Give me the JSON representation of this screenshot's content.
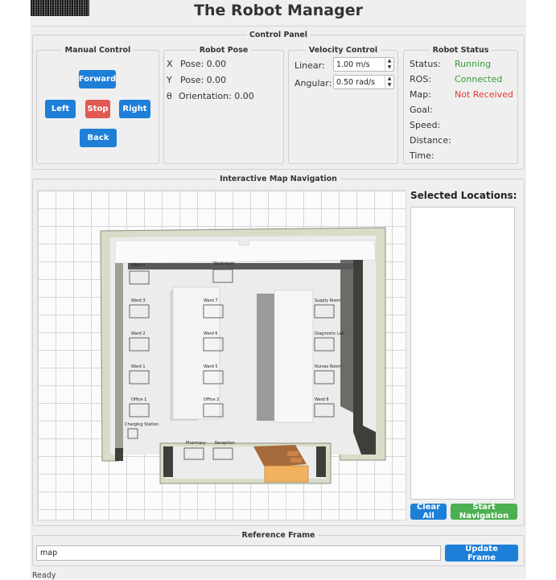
{
  "app": {
    "title": "The Robot Manager"
  },
  "control_panel": {
    "title": "Control Panel",
    "manual": {
      "title": "Manual Control",
      "forward": "Forward",
      "left": "Left",
      "stop": "Stop",
      "right": "Right",
      "back": "Back"
    },
    "pose": {
      "title": "Robot Pose",
      "x_prefix": "X",
      "x_label": "Pose: 0.00",
      "y_prefix": "Y",
      "y_label": "Pose: 0.00",
      "theta_prefix": "θ",
      "theta_label": "Orientation: 0.00"
    },
    "velocity": {
      "title": "Velocity Control",
      "linear_label": "Linear:",
      "linear_value": "1.00 m/s",
      "angular_label": "Angular:",
      "angular_value": "0.50 rad/s"
    },
    "status": {
      "title": "Robot Status",
      "status_label": "Status:",
      "status_value": "Running",
      "ros_label": "ROS:",
      "ros_value": "Connected",
      "map_label": "Map:",
      "map_value": "Not Received",
      "goal_label": "Goal:",
      "speed_label": "Speed:",
      "distance_label": "Distance:",
      "time_label": "Time:",
      "colors": {
        "ok": "#3a9a3a",
        "error": "#e53935"
      }
    }
  },
  "map_nav": {
    "title": "Interactive Map Navigation",
    "selected_title": "Selected Locations:",
    "clear_all": "Clear All",
    "start_navigation": "Start Navigation",
    "rooms": {
      "ward4": "Ward 4",
      "washroom": "Washroom",
      "ward3": "Ward 3",
      "ward7": "Ward 7",
      "supply": "Supply Room",
      "ward2": "Ward 2",
      "ward6": "Ward 6",
      "diagnostic": "Diagnostic Lab",
      "ward1": "Ward 1",
      "ward5": "Ward 5",
      "nurses": "Nurses Room",
      "office1": "Office 1",
      "office2": "Office 2",
      "ward8": "Ward 8",
      "charging": "Charging Station",
      "pharmacy": "Pharmacy",
      "reception": "Reception"
    }
  },
  "reference_frame": {
    "title": "Reference Frame",
    "value": "map",
    "update_button": "Update Frame"
  },
  "status_bar": {
    "text": "Ready"
  }
}
